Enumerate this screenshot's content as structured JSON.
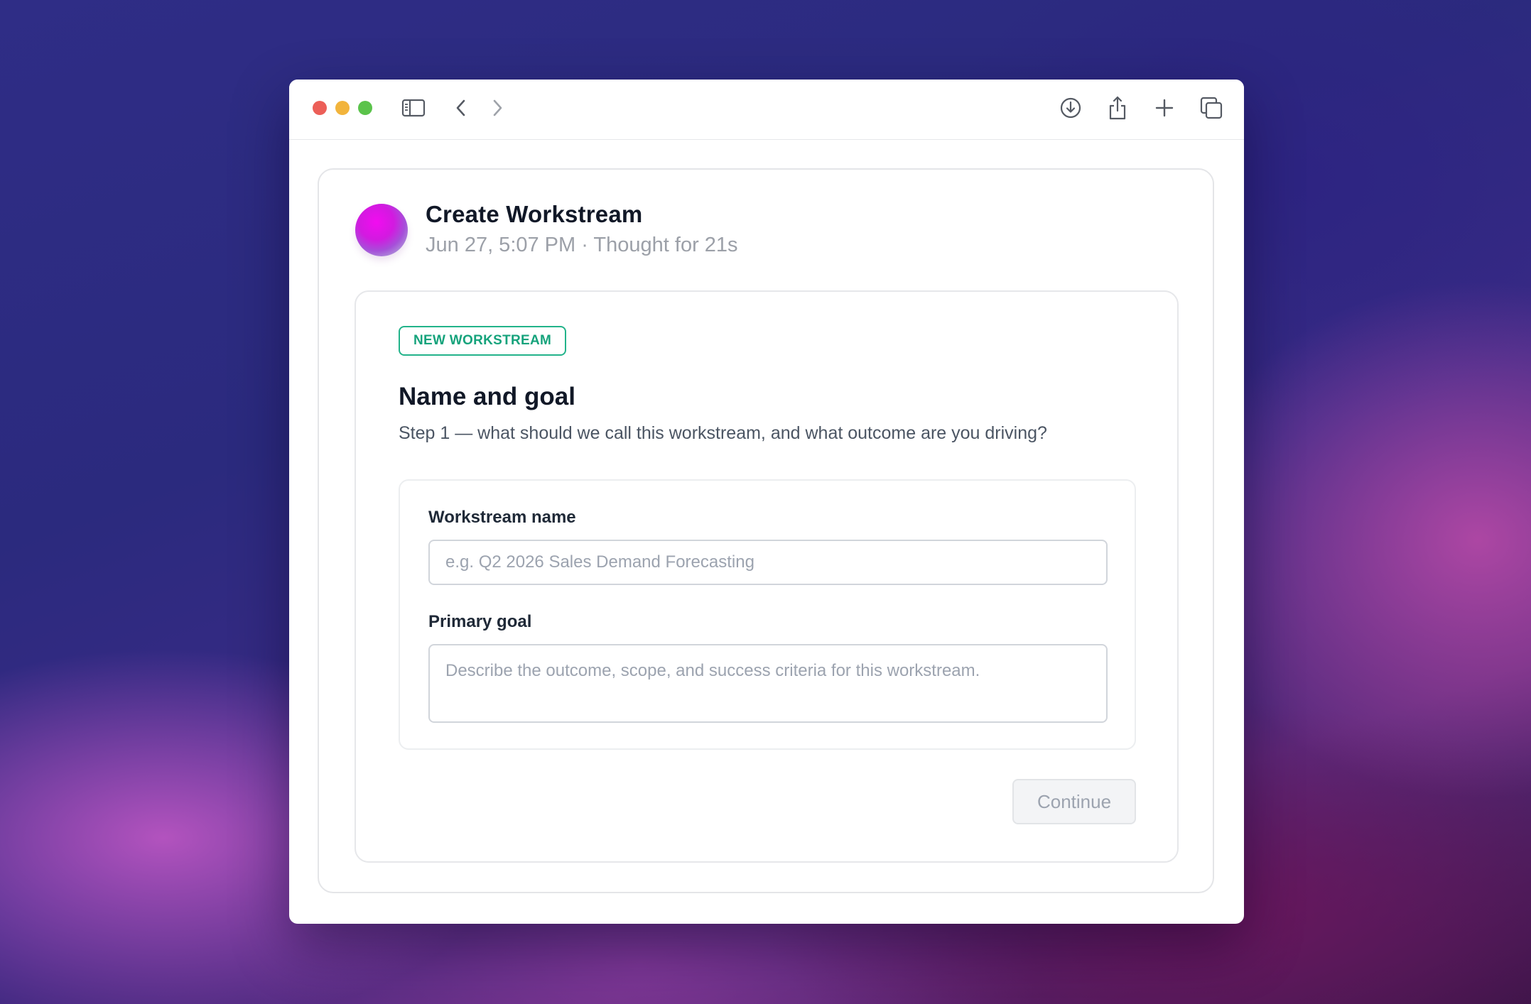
{
  "browser": {
    "toolbar_icons": [
      "sidebar-icon",
      "back-icon",
      "forward-icon",
      "download-icon",
      "share-icon",
      "new-tab-icon",
      "tabs-overview-icon"
    ]
  },
  "header": {
    "title": "Create Workstream",
    "subtitle": "Jun 27, 5:07 PM · Thought for 21s"
  },
  "card": {
    "badge": "NEW WORKSTREAM",
    "heading": "Name and goal",
    "description": "Step 1 — what should we call this workstream, and what outcome are you driving?"
  },
  "form": {
    "name_label": "Workstream name",
    "name_value": "",
    "name_placeholder": "e.g. Q2 2026 Sales Demand Forecasting",
    "goal_label": "Primary goal",
    "goal_value": "",
    "goal_placeholder": "Describe the outcome, scope, and success criteria for this workstream."
  },
  "actions": {
    "continue_label": "Continue"
  },
  "colors": {
    "accent_green": "#16a37c",
    "title_text": "#111827",
    "muted_text": "#9ca0a8"
  }
}
